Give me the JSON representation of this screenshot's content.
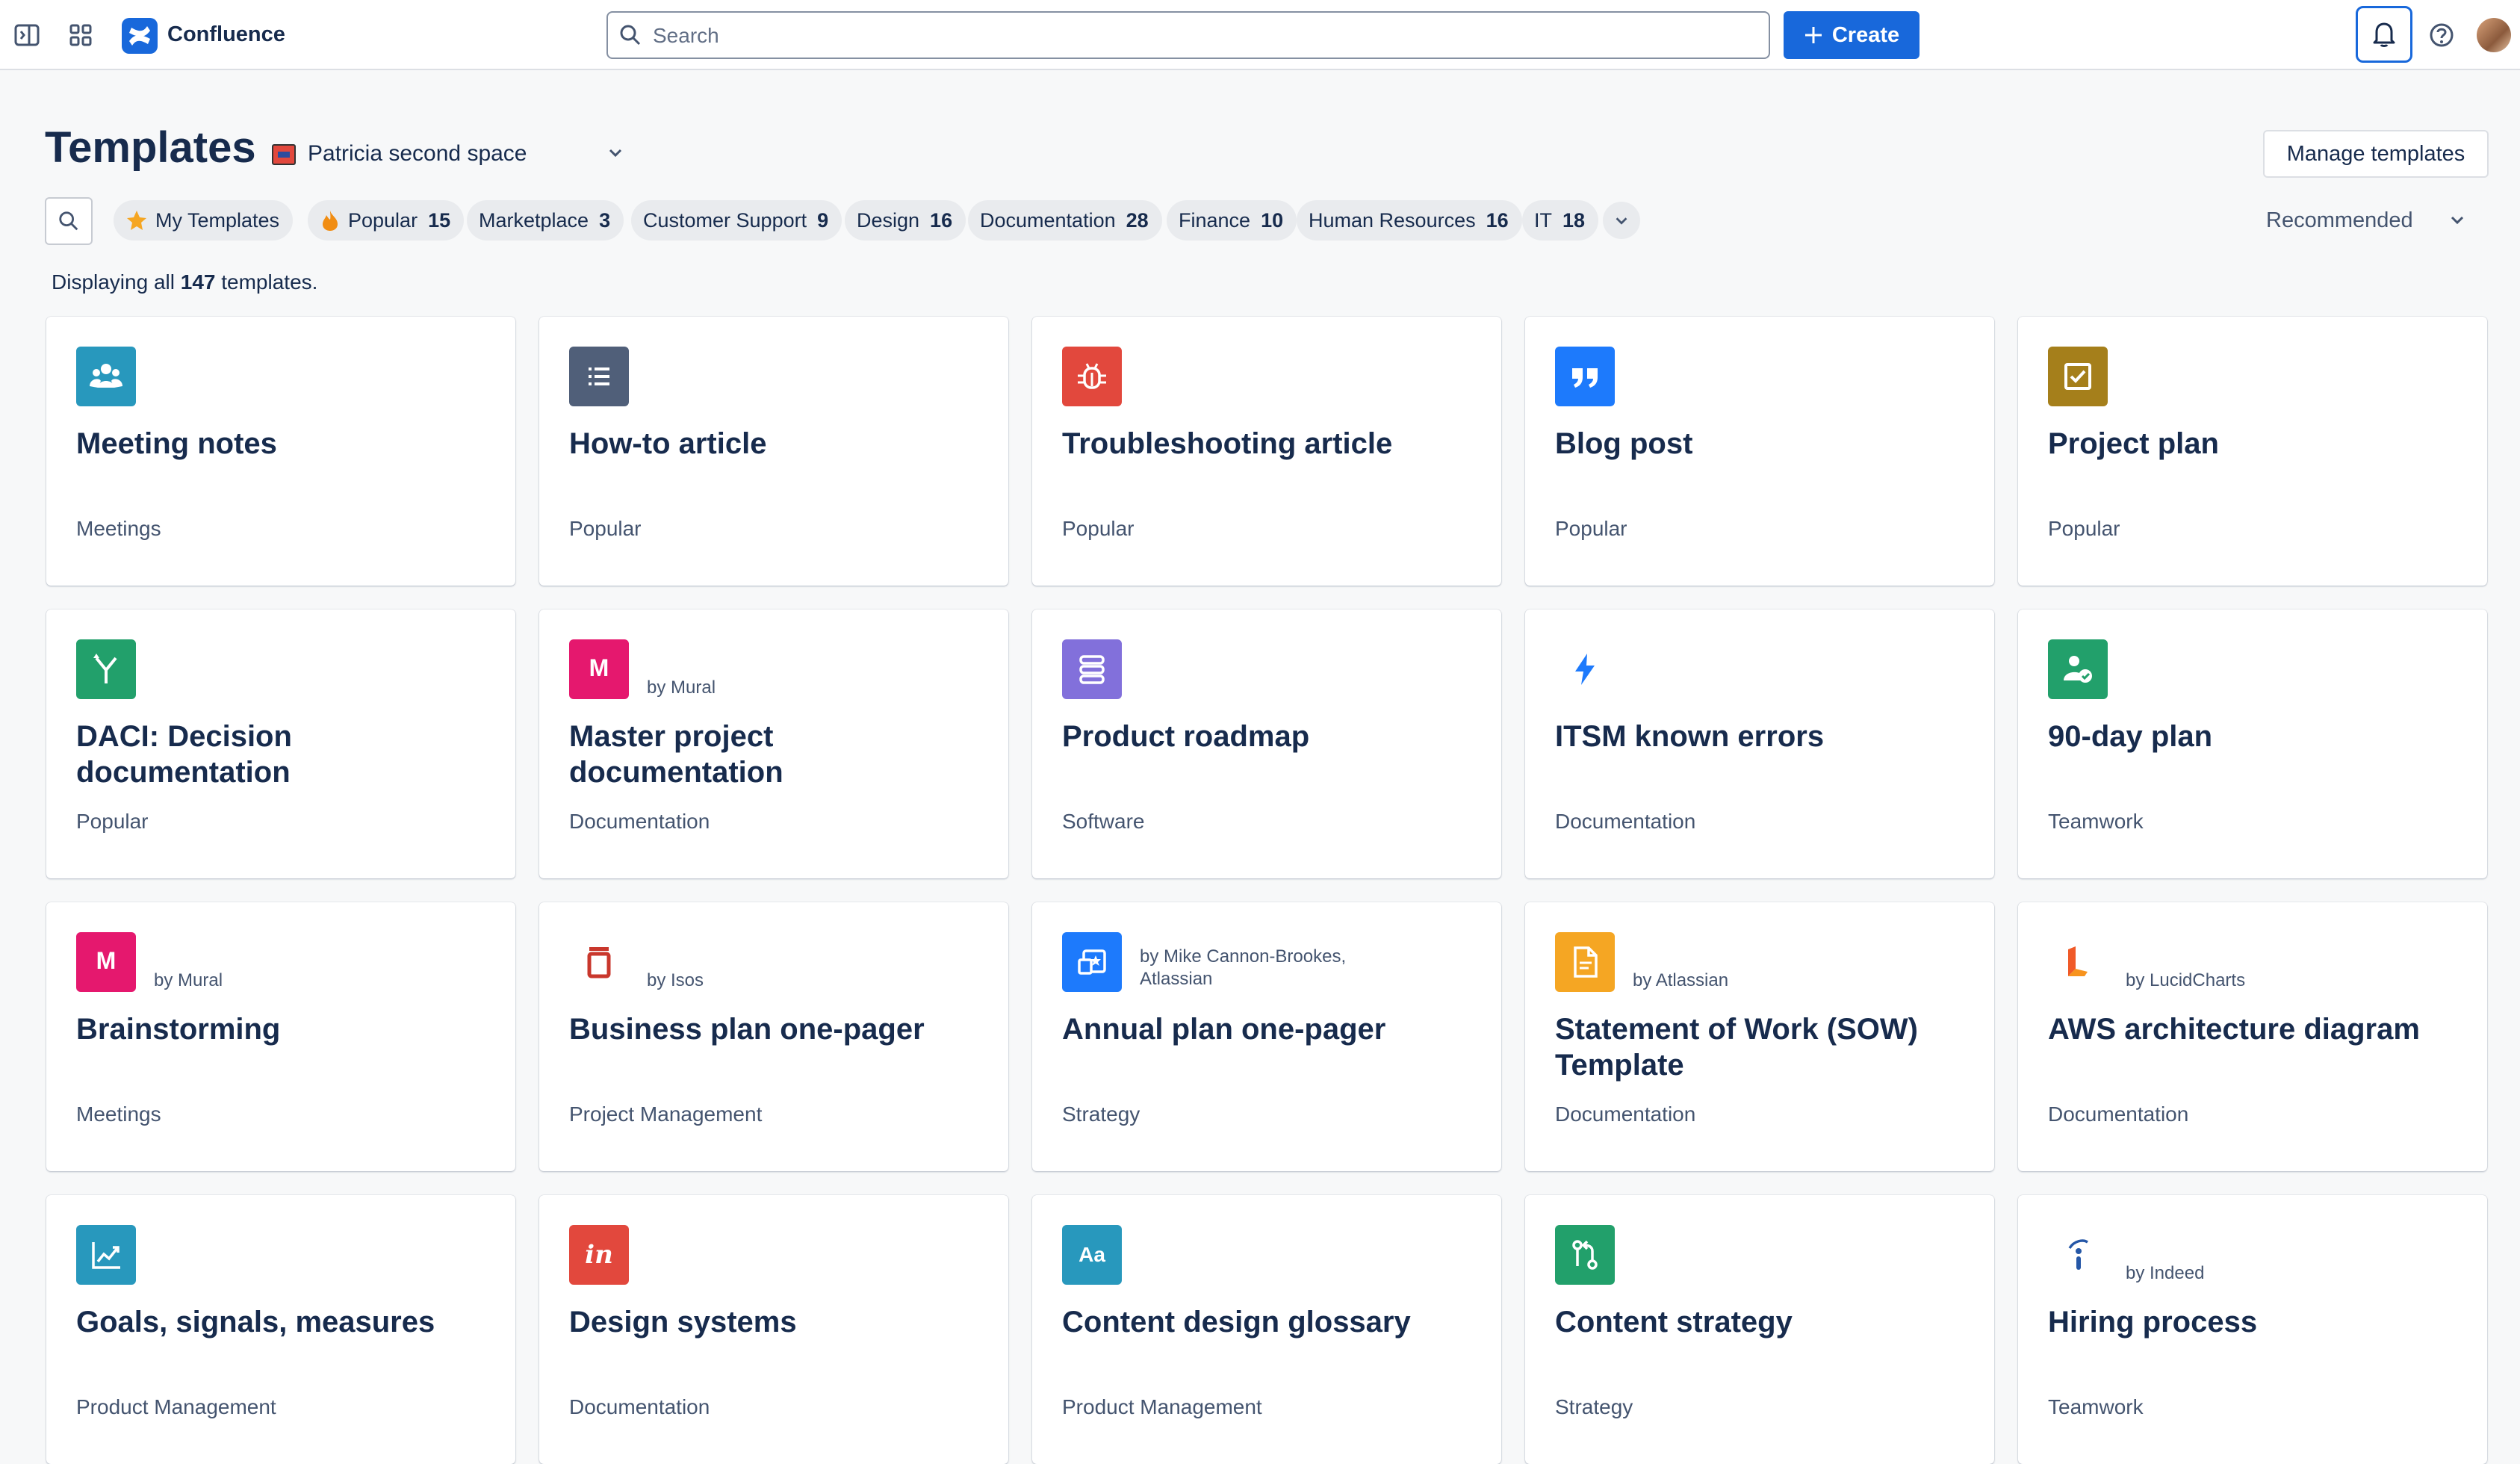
{
  "app": {
    "name": "Confluence",
    "search_placeholder": "Search",
    "create_label": "Create"
  },
  "page": {
    "title": "Templates",
    "space_name": "Patricia second space",
    "manage_label": "Manage templates",
    "sort_label": "Recommended",
    "displaying_prefix": "Displaying all",
    "displaying_count": "147",
    "displaying_suffix": "templates."
  },
  "filters": [
    {
      "label": "My Templates",
      "count": "",
      "icon": "star-icon"
    },
    {
      "label": "Popular",
      "count": "15",
      "icon": "fire-icon"
    },
    {
      "label": "Marketplace",
      "count": "3"
    },
    {
      "label": "Customer Support",
      "count": "9"
    },
    {
      "label": "Design",
      "count": "16"
    },
    {
      "label": "Documentation",
      "count": "28"
    },
    {
      "label": "Finance",
      "count": "10"
    },
    {
      "label": "Human Resources",
      "count": "16"
    },
    {
      "label": "IT",
      "count": "18"
    }
  ],
  "templates": [
    {
      "title": "Meeting notes",
      "category": "Meetings",
      "by": "",
      "icon": "people-icon",
      "color": "#2898bd"
    },
    {
      "title": "How-to article",
      "category": "Popular",
      "by": "",
      "icon": "list-icon",
      "color": "#505f79"
    },
    {
      "title": "Troubleshooting article",
      "category": "Popular",
      "by": "",
      "icon": "bug-icon",
      "color": "#e2483d"
    },
    {
      "title": "Blog post",
      "category": "Popular",
      "by": "",
      "icon": "quote-icon",
      "color": "#1d7afc"
    },
    {
      "title": "Project plan",
      "category": "Popular",
      "by": "",
      "icon": "checkbox-icon",
      "color": "#a57f1b"
    },
    {
      "title": "DACI: Decision documentation",
      "category": "Popular",
      "by": "",
      "icon": "branch-icon",
      "color": "#22a06b"
    },
    {
      "title": "Master project documentation",
      "category": "Documentation",
      "by": "by Mural",
      "icon": "mural-icon",
      "color": "#e5186e"
    },
    {
      "title": "Product roadmap",
      "category": "Software",
      "by": "",
      "icon": "roadmap-icon",
      "color": "#8270db"
    },
    {
      "title": "ITSM known errors",
      "category": "Documentation",
      "by": "",
      "icon": "lightning-icon",
      "color": "#ffffff"
    },
    {
      "title": "90-day plan",
      "category": "Teamwork",
      "by": "",
      "icon": "person-check-icon",
      "color": "#22a06b"
    },
    {
      "title": "Brainstorming",
      "category": "Meetings",
      "by": "by Mural",
      "icon": "mural-icon",
      "color": "#e5186e"
    },
    {
      "title": "Business plan one-pager",
      "category": "Project Management",
      "by": "by Isos",
      "icon": "isos-icon",
      "color": "#ffffff"
    },
    {
      "title": "Annual plan one-pager",
      "category": "Strategy",
      "by": "by Mike Cannon-Brookes, Atlassian",
      "icon": "plan-icon",
      "color": "#1d7afc"
    },
    {
      "title": "Statement of Work (SOW) Template",
      "category": "Documentation",
      "by": "by Atlassian",
      "icon": "document-icon",
      "color": "#f5a623"
    },
    {
      "title": "AWS architecture diagram",
      "category": "Documentation",
      "by": "by LucidCharts",
      "icon": "lucid-icon",
      "color": "#ffffff"
    },
    {
      "title": "Goals, signals, measures",
      "category": "Product Management",
      "by": "",
      "icon": "chart-icon",
      "color": "#2898bd"
    },
    {
      "title": "Design systems",
      "category": "Documentation",
      "by": "",
      "icon": "invision-icon",
      "color": "#e2483d"
    },
    {
      "title": "Content design glossary",
      "category": "Product Management",
      "by": "",
      "icon": "text-icon",
      "color": "#2898bd"
    },
    {
      "title": "Content strategy",
      "category": "Strategy",
      "by": "",
      "icon": "flow-icon",
      "color": "#22a06b"
    },
    {
      "title": "Hiring process",
      "category": "Teamwork",
      "by": "by Indeed",
      "icon": "indeed-icon",
      "color": "#ffffff"
    }
  ]
}
